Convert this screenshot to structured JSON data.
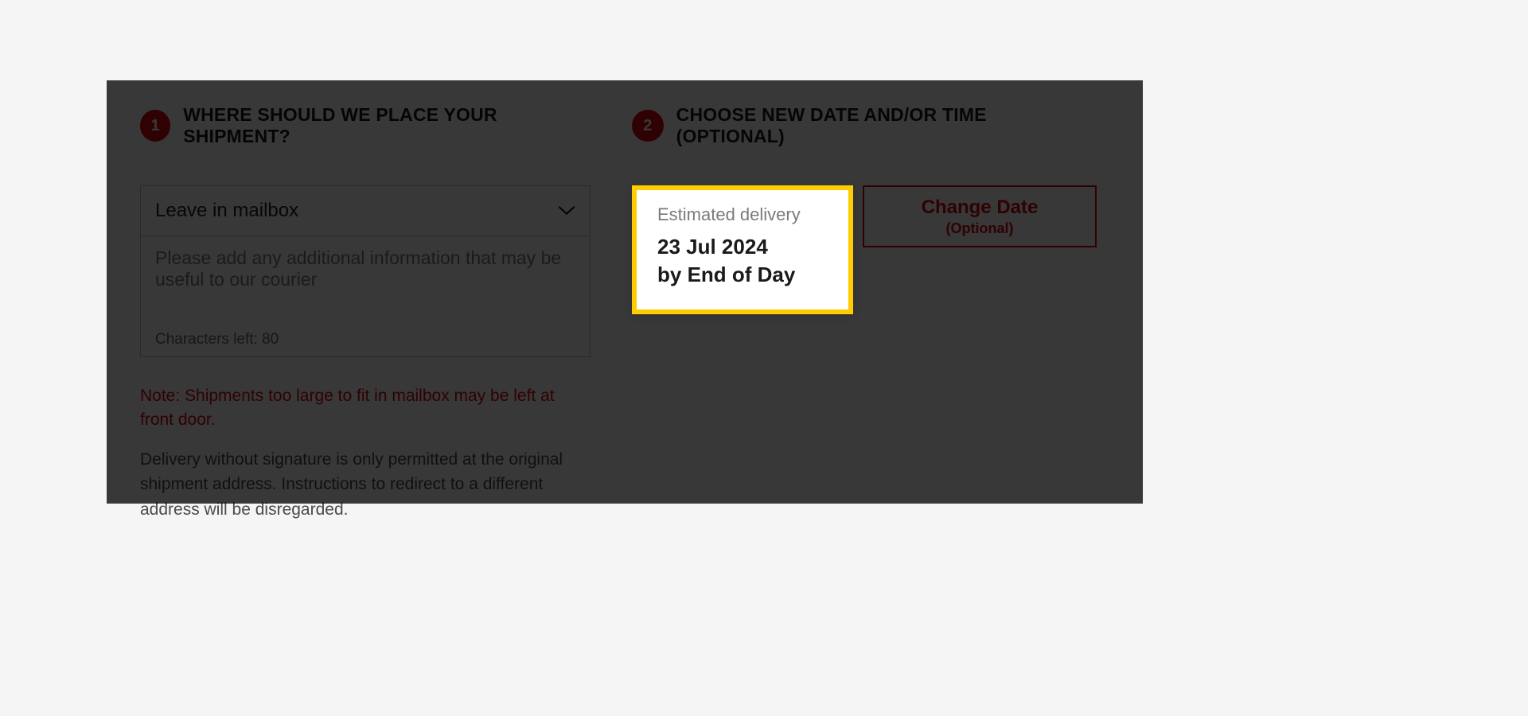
{
  "step1": {
    "number": "1",
    "title": "WHERE SHOULD WE PLACE YOUR SHIPMENT?",
    "select_value": "Leave in mailbox",
    "textarea_placeholder": "Please add any additional information that may be useful to our courier",
    "char_counter": "Characters left: 80",
    "note_red": "Note: Shipments too large to fit in mailbox may be left at front door.",
    "note_grey": "Delivery without signature is only permitted at the original shipment address. Instructions to redirect to a different address will be disregarded."
  },
  "step2": {
    "number": "2",
    "title": "CHOOSE NEW DATE AND/OR TIME (OPTIONAL)",
    "estimated_label": "Estimated delivery",
    "date_line1": "23 Jul 2024",
    "date_line2": "by End of Day",
    "change_main": "Change Date",
    "change_sub": "(Optional)"
  }
}
